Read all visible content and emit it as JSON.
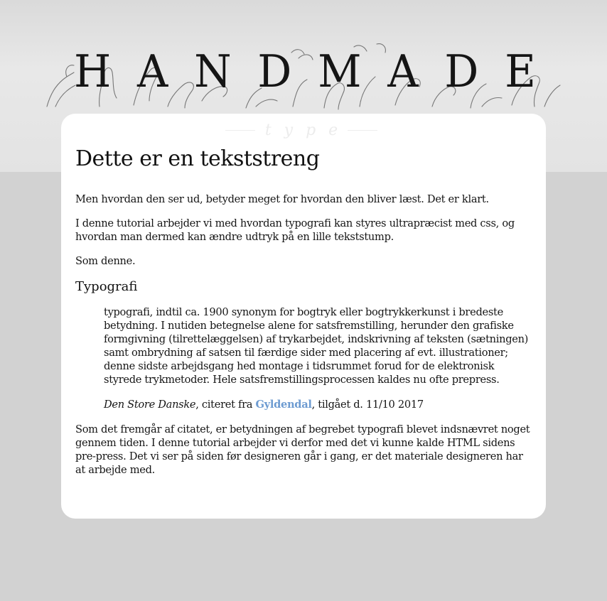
{
  "header": {
    "logo_letters": [
      "H",
      "A",
      "N",
      "D",
      "M",
      "A",
      "D",
      "E"
    ],
    "tagline": "type"
  },
  "article": {
    "title": "Dette er en tekststreng",
    "intro": "Men hvordan den ser ud, betyder meget for hvordan den bliver læst. Det er klart.",
    "paragraph_2": "I denne tutorial arbejder vi med hvordan typografi kan styres ultrapræcist med css, og hvordan man dermed kan ændre udtryk på en lille tekststump.",
    "paragraph_3": "Som denne.",
    "subheading": "Typografi",
    "quote": {
      "term": "typografi",
      "text": ", indtil ca. 1900 synonym for bogtryk eller bogtrykkerkunst i bredeste betydning. I nutiden betegnelse alene for satsfremstilling, herunder den grafiske formgivning (tilrettelæggelsen) af trykarbejdet, indskrivning af teksten (sætningen) samt ombrydning af satsen til færdige sider med placering af evt. illustrationer; denne sidste arbejdsgang hed montage i tidsrummet forud for de elektronisk styrede trykmetoder. Hele satsfremstillingsprocessen kaldes nu ofte prepress."
    },
    "citation": {
      "source": "Den Store Danske",
      "middle": ", citeret fra ",
      "link_label": "Gyldendal",
      "end": ", tilgået d. 11/10 2017"
    },
    "closing": "Som det fremgår af citatet, er betydningen af begrebet typografi blevet indsnævret noget gennem tiden. I denne tutorial arbejder vi derfor med det vi kunne kalde HTML sidens pre-press. Det vi ser på siden før designeren går i gang, er det materiale designeren har at arbejde med."
  },
  "colors": {
    "link": "#6d9bd1",
    "page_background": "#d2d2d2",
    "card_background": "#ffffff"
  }
}
